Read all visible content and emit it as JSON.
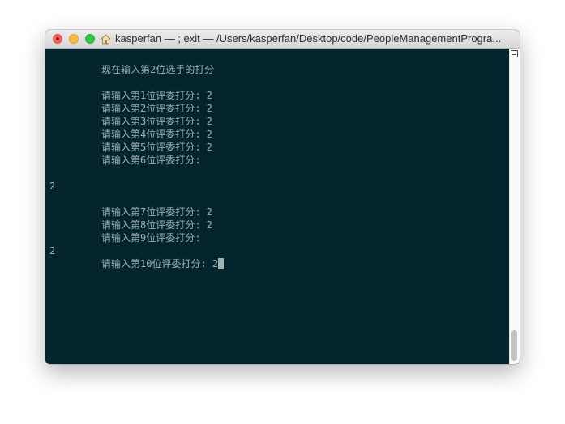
{
  "window": {
    "title": "kasperfan — ; exit — /Users/kasperfan/Desktop/code/PeopleManagementProgra..."
  },
  "terminal": {
    "lines": [
      {
        "indent": true,
        "text": "现在输入第2位选手的打分"
      },
      {
        "indent": true,
        "text": ""
      },
      {
        "indent": true,
        "text": "请输入第1位评委打分: 2"
      },
      {
        "indent": true,
        "text": "请输入第2位评委打分: 2"
      },
      {
        "indent": true,
        "text": "请输入第3位评委打分: 2"
      },
      {
        "indent": true,
        "text": "请输入第4位评委打分: 2"
      },
      {
        "indent": true,
        "text": "请输入第5位评委打分: 2"
      },
      {
        "indent": true,
        "text": "请输入第6位评委打分:"
      },
      {
        "indent": false,
        "text": ""
      },
      {
        "indent": false,
        "text": "2"
      },
      {
        "indent": false,
        "text": ""
      },
      {
        "indent": true,
        "text": "请输入第7位评委打分: 2"
      },
      {
        "indent": true,
        "text": "请输入第8位评委打分: 2"
      },
      {
        "indent": true,
        "text": "请输入第9位评委打分:"
      },
      {
        "indent": false,
        "text": "2"
      },
      {
        "indent": true,
        "text": "请输入第10位评委打分: 2"
      }
    ],
    "cursor_line": 15
  },
  "colors": {
    "terminal_background": "#05252e",
    "terminal_text": "#9fb1b4",
    "close_button": "#fc605c",
    "minimize_button": "#fdbc40",
    "zoom_button": "#34c84a"
  },
  "icons": {
    "title_icon": "home-icon",
    "scrollbar_button": "split-pane-icon"
  }
}
